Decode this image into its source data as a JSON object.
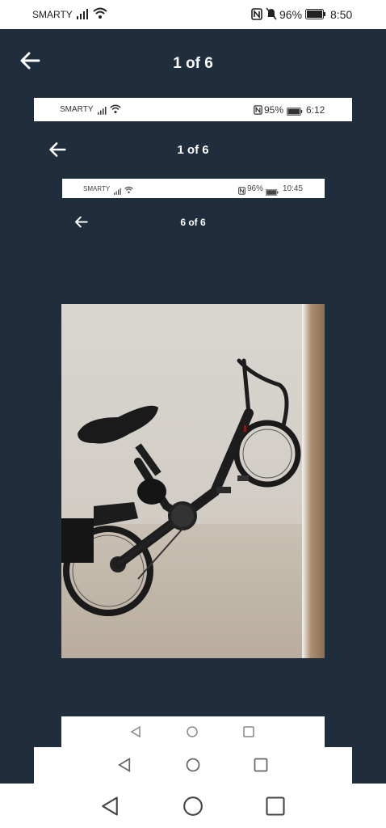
{
  "status_bar": {
    "carrier": "SMARTY",
    "battery": "96%",
    "time": "8:50"
  },
  "header": {
    "back_icon": "arrow-left-icon",
    "counter": "1 of 6"
  },
  "nested_screenshot_1": {
    "status_bar": {
      "carrier": "SMARTY",
      "battery": "95%",
      "time": "6:12"
    },
    "counter": "1 of 6"
  },
  "nested_screenshot_2": {
    "status_bar": {
      "carrier": "SMARTY",
      "battery": "96%",
      "time": "10:45"
    },
    "counter": "6 of 6"
  },
  "photo": {
    "subject": "folding e-bike"
  },
  "nav_bar": {
    "back": "triangle-back-icon",
    "home": "circle-home-icon",
    "recents": "square-recents-icon"
  },
  "colors": {
    "background": "#1f2d3d",
    "white": "#ffffff"
  }
}
